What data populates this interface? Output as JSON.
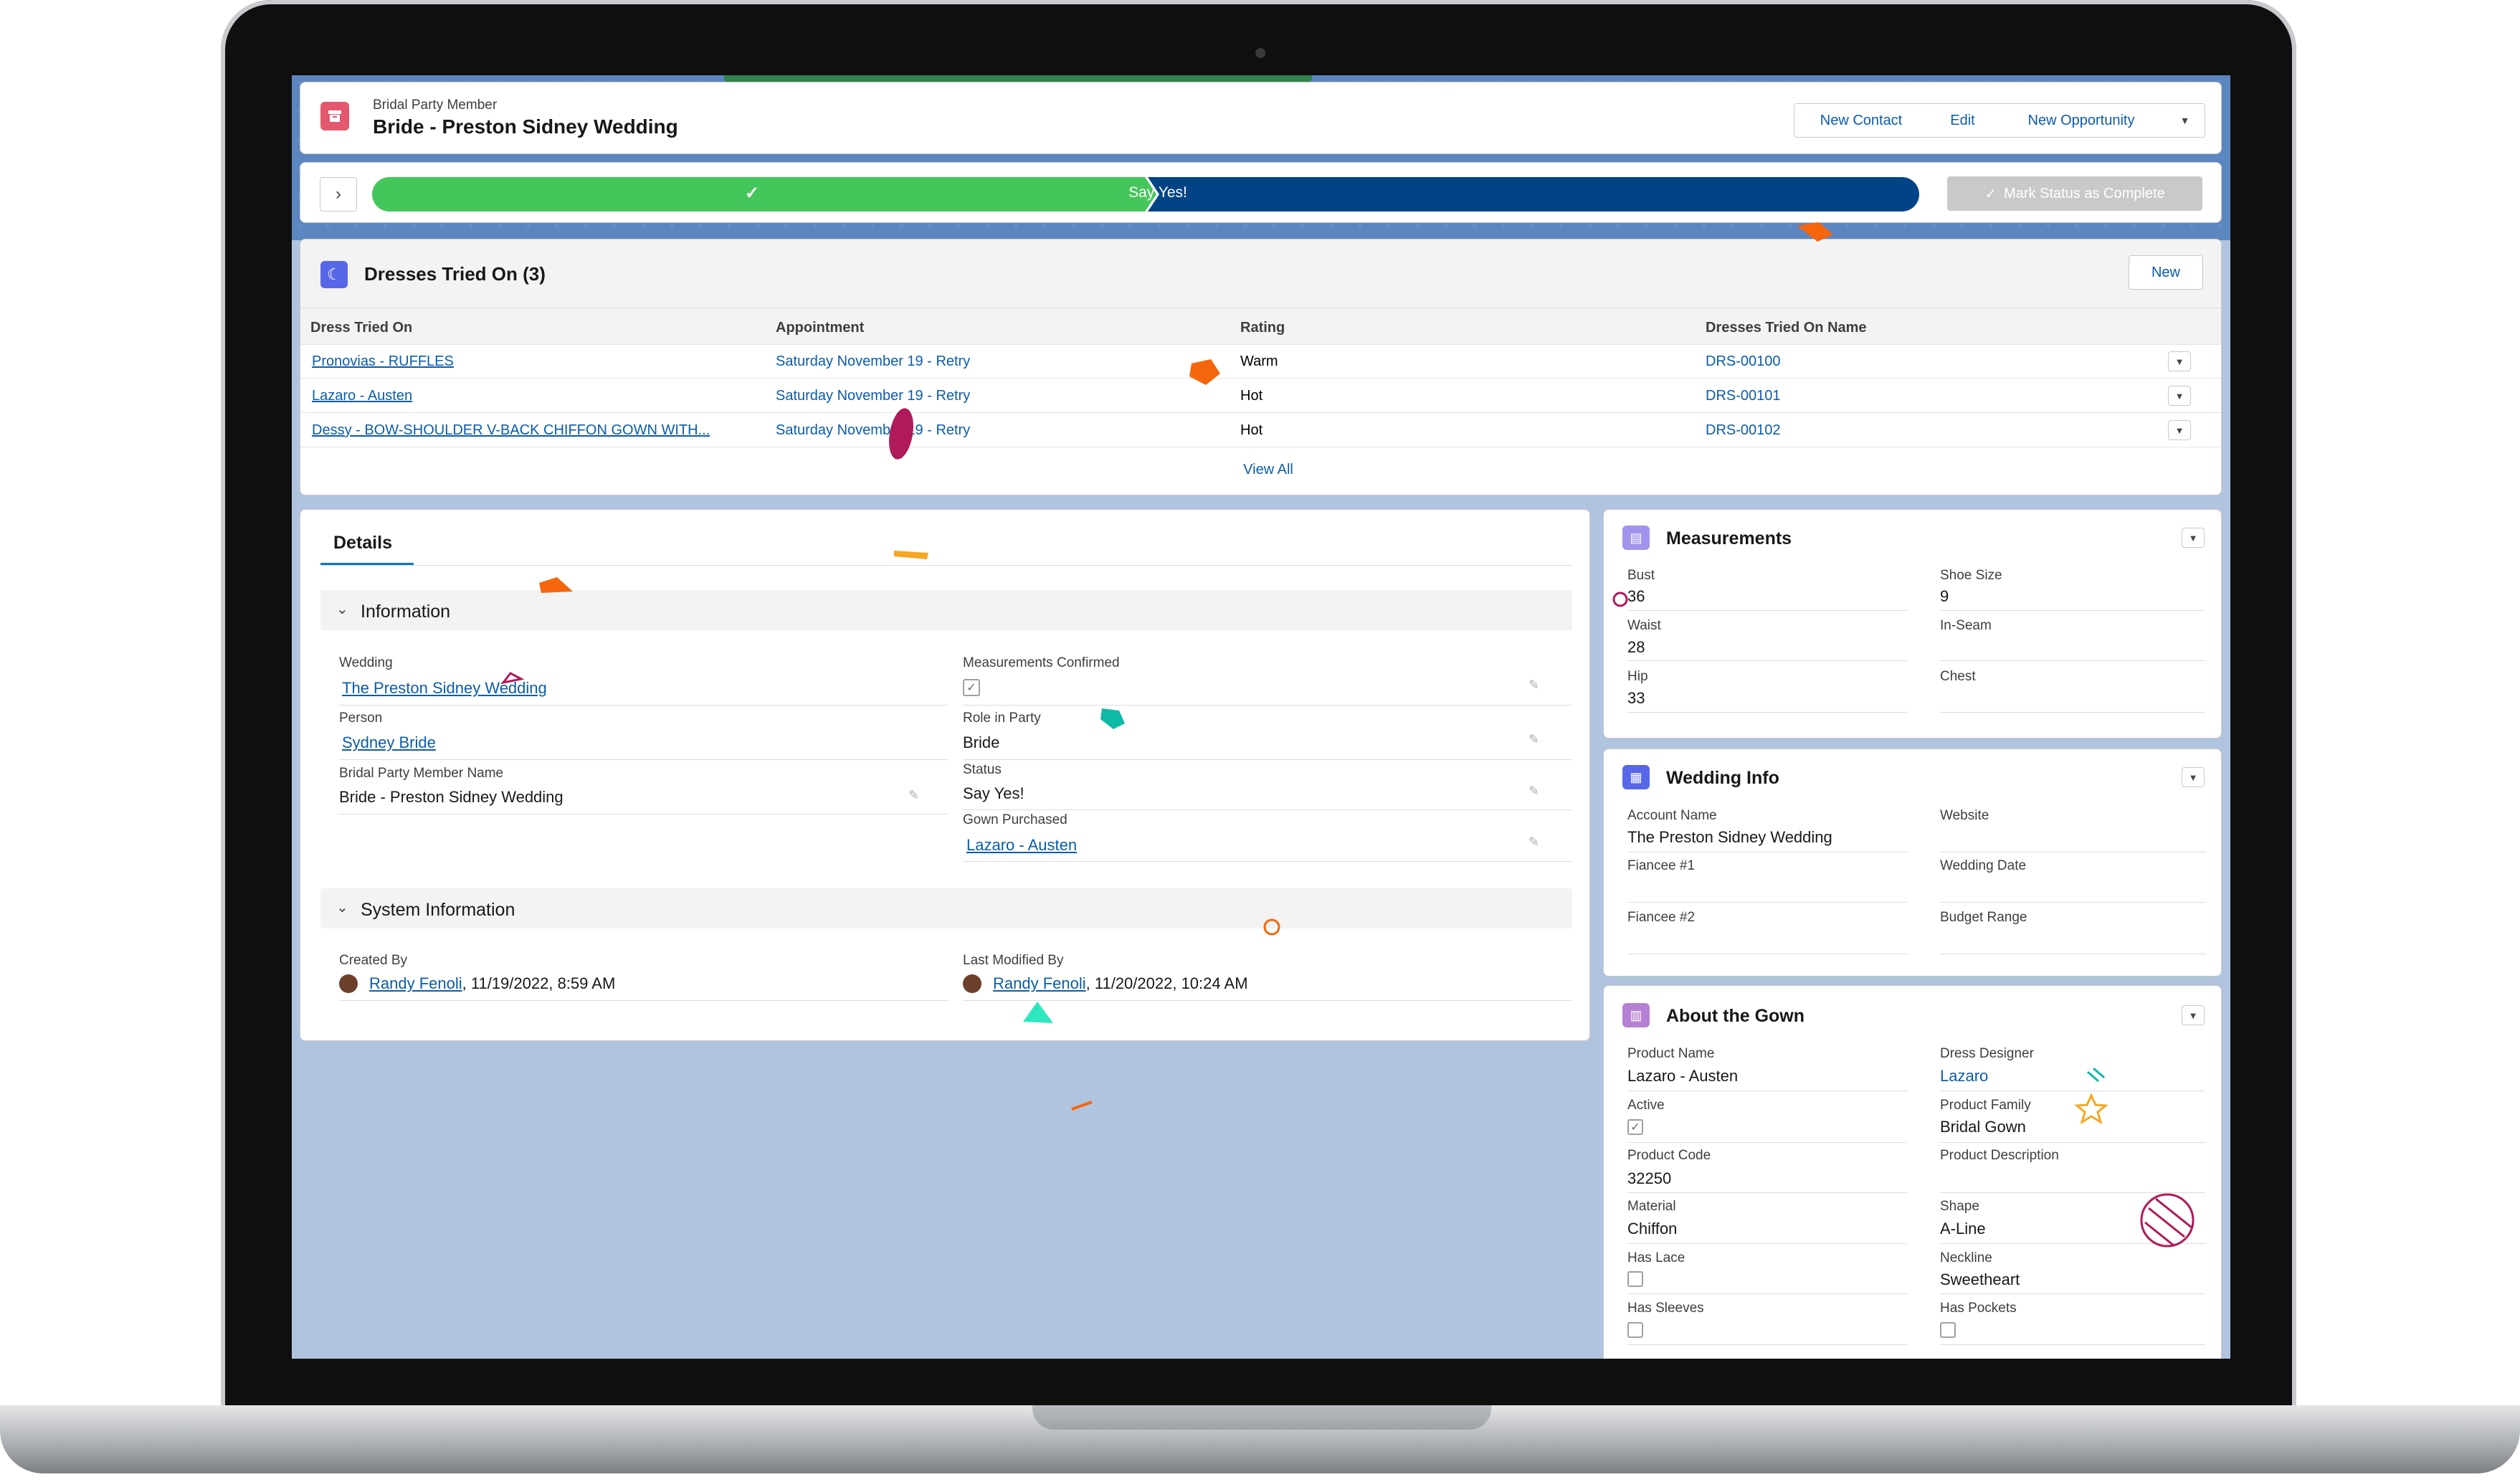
{
  "record": {
    "object_label": "Bridal Party Member",
    "title": "Bride - Preston Sidney Wedding",
    "actions": [
      "New Contact",
      "Edit",
      "New Opportunity"
    ]
  },
  "path": {
    "completed_glyph": "✓",
    "current_stage": "Say Yes!",
    "mark_button": "Mark Status as Complete"
  },
  "dresses": {
    "title": "Dresses Tried On (3)",
    "new_button": "New",
    "columns": [
      "Dress Tried On",
      "Appointment",
      "Rating",
      "Dresses Tried On Name"
    ],
    "rows": [
      {
        "dress": "Pronovias - RUFFLES",
        "appointment": "Saturday November 19 - Retry",
        "rating": "Warm",
        "name": "DRS-00100"
      },
      {
        "dress": "Lazaro - Austen",
        "appointment": "Saturday November 19 - Retry",
        "rating": "Hot",
        "name": "DRS-00101"
      },
      {
        "dress": "Dessy - BOW-SHOULDER V-BACK CHIFFON GOWN WITH...",
        "appointment": "Saturday November 19 - Retry",
        "rating": "Hot",
        "name": "DRS-00102"
      }
    ],
    "view_all": "View All"
  },
  "details": {
    "tab": "Details",
    "information_title": "Information",
    "left": [
      {
        "label": "Wedding",
        "value": "The Preston Sidney Wedding"
      },
      {
        "label": "Person",
        "value": "Sydney Bride"
      },
      {
        "label": "Bridal Party Member Name",
        "value": "Bride - Preston Sidney Wedding"
      }
    ],
    "right": [
      {
        "label": "Measurements Confirmed",
        "value": ""
      },
      {
        "label": "Role in Party",
        "value": "Bride"
      },
      {
        "label": "Status",
        "value": "Say Yes!"
      },
      {
        "label": "Gown Purchased",
        "value": "Lazaro - Austen"
      }
    ],
    "system_title": "System Information",
    "created_by_label": "Created By",
    "created_by_user": "Randy Fenoli",
    "created_by_date": ", 11/19/2022, 8:59 AM",
    "modified_by_label": "Last Modified By",
    "modified_by_user": "Randy Fenoli",
    "modified_by_date": ", 11/20/2022, 10:24 AM"
  },
  "measurements": {
    "title": "Measurements",
    "left": [
      {
        "label": "Bust",
        "value": "36"
      },
      {
        "label": "Waist",
        "value": "28"
      },
      {
        "label": "Hip",
        "value": "33"
      }
    ],
    "right": [
      {
        "label": "Shoe Size",
        "value": "9"
      },
      {
        "label": "In-Seam",
        "value": ""
      },
      {
        "label": "Chest",
        "value": ""
      }
    ]
  },
  "wedding_info": {
    "title": "Wedding Info",
    "left": [
      {
        "label": "Account Name",
        "value": "The Preston Sidney Wedding"
      },
      {
        "label": "Fiancee #1",
        "value": ""
      },
      {
        "label": "Fiancee #2",
        "value": ""
      }
    ],
    "right": [
      {
        "label": "Website",
        "value": ""
      },
      {
        "label": "Wedding Date",
        "value": ""
      },
      {
        "label": "Budget Range",
        "value": ""
      }
    ]
  },
  "gown": {
    "title": "About the Gown",
    "left": [
      {
        "label": "Product Name",
        "value": "Lazaro - Austen"
      },
      {
        "label": "Active",
        "value": ""
      },
      {
        "label": "Product Code",
        "value": "32250"
      },
      {
        "label": "Material",
        "value": "Chiffon"
      },
      {
        "label": "Has Lace",
        "value": ""
      },
      {
        "label": "Has Sleeves",
        "value": ""
      }
    ],
    "right": [
      {
        "label": "Dress Designer",
        "value": "Lazaro"
      },
      {
        "label": "Product Family",
        "value": "Bridal Gown"
      },
      {
        "label": "Product Description",
        "value": ""
      },
      {
        "label": "Shape",
        "value": "A-Line"
      },
      {
        "label": "Neckline",
        "value": "Sweetheart"
      },
      {
        "label": "Has Pockets",
        "value": ""
      }
    ]
  },
  "colors": {
    "brand_blue": "#0b5cab",
    "path_complete": "#45c65a",
    "path_current": "#014486",
    "record_icon": "#e3586e"
  }
}
